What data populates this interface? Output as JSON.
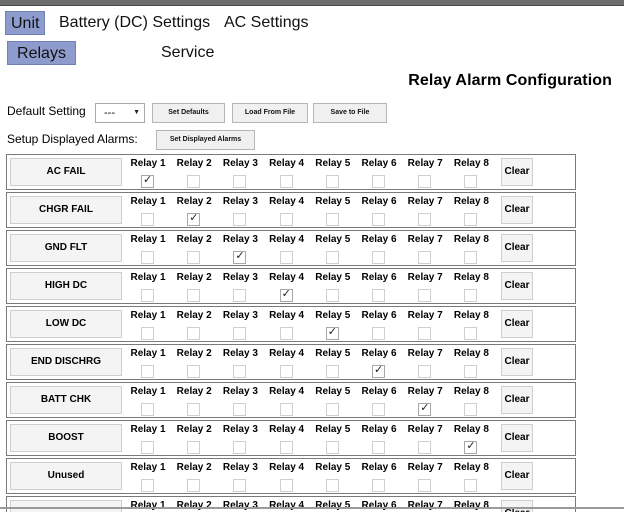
{
  "nav": {
    "tabs": [
      {
        "label": "Unit"
      },
      {
        "label": "Battery (DC) Settings"
      },
      {
        "label": "AC Settings"
      },
      {
        "label": "Relays"
      },
      {
        "label": "Service"
      }
    ]
  },
  "page": {
    "title": "Relay Alarm Configuration"
  },
  "controls": {
    "default_setting_label": "Default Setting",
    "default_setting_value": "---",
    "set_defaults": "Set Defaults",
    "load_from_file": "Load From File",
    "save_to_file": "Save to File",
    "setup_label": "Setup Displayed Alarms:",
    "set_displayed": "Set Displayed Alarms"
  },
  "relay_labels": [
    "Relay 1",
    "Relay 2",
    "Relay 3",
    "Relay 4",
    "Relay 5",
    "Relay 6",
    "Relay 7",
    "Relay 8"
  ],
  "clear_label": "Clear",
  "alarms": [
    {
      "name": "AC FAIL",
      "checked": [
        1
      ]
    },
    {
      "name": "CHGR FAIL",
      "checked": [
        2
      ]
    },
    {
      "name": "GND FLT",
      "checked": [
        3
      ]
    },
    {
      "name": "HIGH DC",
      "checked": [
        4
      ]
    },
    {
      "name": "LOW DC",
      "checked": [
        5
      ]
    },
    {
      "name": "END DISCHRG",
      "checked": [
        6
      ]
    },
    {
      "name": "BATT CHK",
      "checked": [
        7
      ]
    },
    {
      "name": "BOOST",
      "checked": [
        8
      ]
    },
    {
      "name": "Unused",
      "checked": []
    },
    {
      "name": "",
      "checked": []
    }
  ],
  "icons": {
    "dropdown": "chevron-down-icon",
    "check": "check-icon"
  },
  "colors": {
    "active_tab": "#8e9ccd",
    "border": "#7a7a7a"
  }
}
